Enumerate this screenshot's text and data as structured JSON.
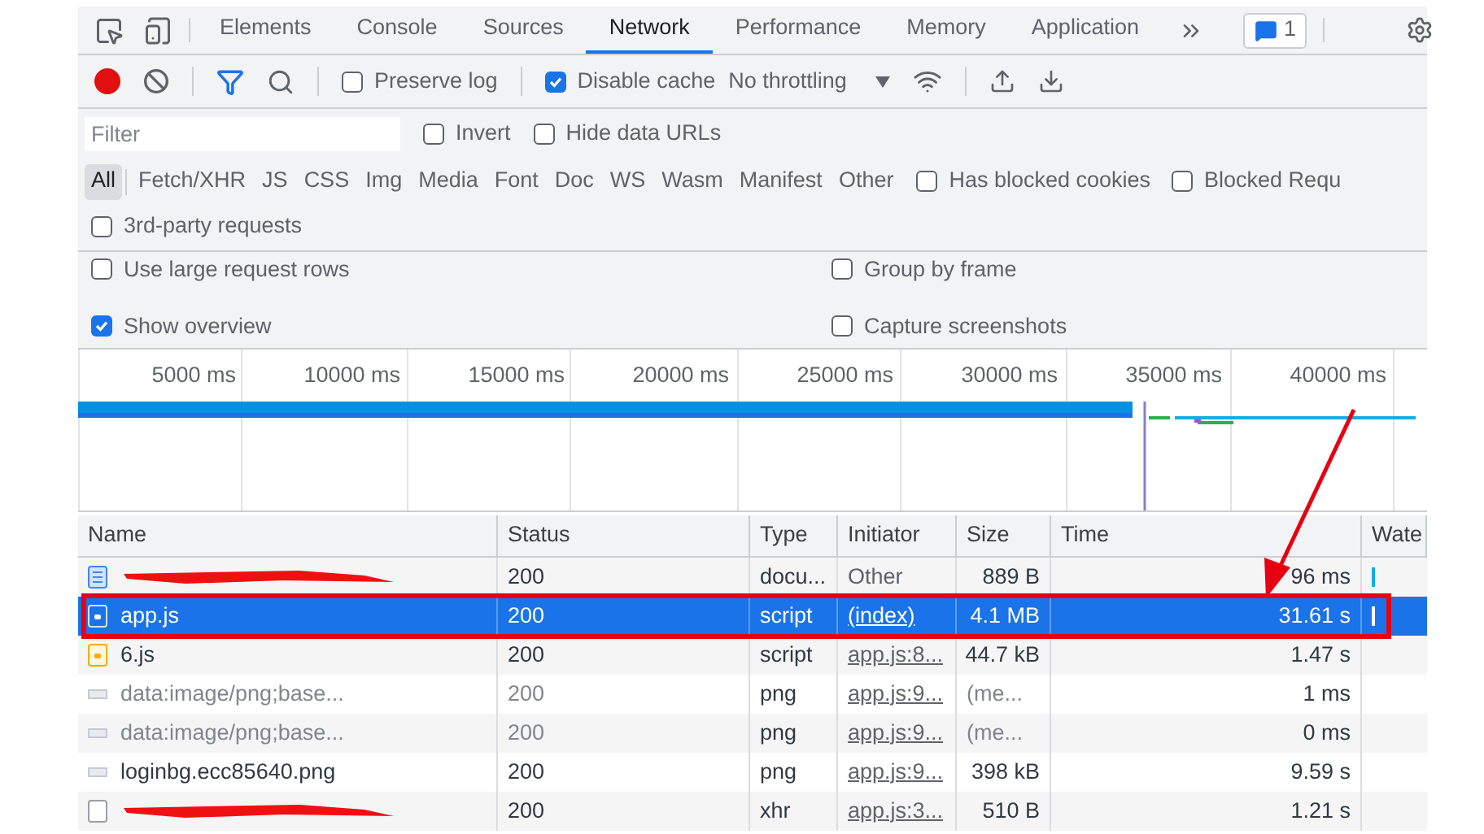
{
  "tabs": [
    {
      "label": "Elements",
      "selected": false
    },
    {
      "label": "Console",
      "selected": false
    },
    {
      "label": "Sources",
      "selected": false
    },
    {
      "label": "Network",
      "selected": true
    },
    {
      "label": "Performance",
      "selected": false
    },
    {
      "label": "Memory",
      "selected": false
    },
    {
      "label": "Application",
      "selected": false
    }
  ],
  "issues_badge": "1",
  "toolbar": {
    "recording": true,
    "filter_on": true,
    "preserve_log": {
      "label": "Preserve log",
      "checked": false
    },
    "disable_cache": {
      "label": "Disable cache",
      "checked": true
    },
    "throttling": "No throttling"
  },
  "filter": {
    "placeholder": "Filter",
    "options": [
      {
        "label": "Invert",
        "checked": false
      },
      {
        "label": "Hide data URLs",
        "checked": false
      }
    ]
  },
  "types": [
    {
      "label": "All",
      "selected": true
    },
    {
      "label": "Fetch/XHR",
      "selected": false
    },
    {
      "label": "JS",
      "selected": false
    },
    {
      "label": "CSS",
      "selected": false
    },
    {
      "label": "Img",
      "selected": false
    },
    {
      "label": "Media",
      "selected": false
    },
    {
      "label": "Font",
      "selected": false
    },
    {
      "label": "Doc",
      "selected": false
    },
    {
      "label": "WS",
      "selected": false
    },
    {
      "label": "Wasm",
      "selected": false
    },
    {
      "label": "Manifest",
      "selected": false
    },
    {
      "label": "Other",
      "selected": false
    }
  ],
  "type_options": [
    {
      "label": "Has blocked cookies",
      "checked": false
    },
    {
      "label": "Blocked Requ",
      "checked": false
    }
  ],
  "third_party": {
    "label": "3rd-party requests",
    "checked": false
  },
  "settings": [
    {
      "label": "Use large request rows",
      "checked": false
    },
    {
      "label": "Group by frame",
      "checked": false
    },
    {
      "label": "Show overview",
      "checked": true
    },
    {
      "label": "Capture screenshots",
      "checked": false
    }
  ],
  "overview": {
    "ticks": [
      "5000 ms",
      "10000 ms",
      "15000 ms",
      "20000 ms",
      "25000 ms",
      "30000 ms",
      "35000 ms",
      "40000 ms"
    ]
  },
  "table": {
    "columns": [
      "Name",
      "Status",
      "Type",
      "Initiator",
      "Size",
      "Time",
      "Wate"
    ],
    "rows": [
      {
        "kind": "doc",
        "redacted": true,
        "status": "200",
        "type": "docu...",
        "initiator": "Other",
        "initiator_link": false,
        "size": "889 B",
        "time": "96 ms",
        "selected": false,
        "dimmed": false
      },
      {
        "kind": "script",
        "redacted": false,
        "name": "app.js",
        "status": "200",
        "type": "script",
        "initiator": "(index)",
        "initiator_link": true,
        "size": "4.1 MB",
        "time": "31.61 s",
        "selected": true,
        "dimmed": false
      },
      {
        "kind": "script",
        "redacted": false,
        "name": "6.js",
        "status": "200",
        "type": "script",
        "initiator": "app.js:8...",
        "initiator_link": true,
        "size": "44.7 kB",
        "time": "1.47 s",
        "selected": false,
        "dimmed": false
      },
      {
        "kind": "image",
        "redacted": false,
        "name": "data:image/png;base...",
        "status": "200",
        "type": "png",
        "initiator": "app.js:9...",
        "initiator_link": true,
        "size": "(me...",
        "time": "1 ms",
        "selected": false,
        "dimmed": true
      },
      {
        "kind": "image",
        "redacted": false,
        "name": "data:image/png;base...",
        "status": "200",
        "type": "png",
        "initiator": "app.js:9...",
        "initiator_link": true,
        "size": "(me...",
        "time": "0 ms",
        "selected": false,
        "dimmed": true
      },
      {
        "kind": "image",
        "redacted": false,
        "name": "loginbg.ecc85640.png",
        "status": "200",
        "type": "png",
        "initiator": "app.js:9...",
        "initiator_link": true,
        "size": "398 kB",
        "time": "9.59 s",
        "selected": false,
        "dimmed": false
      },
      {
        "kind": "file",
        "redacted": true,
        "status": "200",
        "type": "xhr",
        "initiator": "app.js:3...",
        "initiator_link": true,
        "size": "510 B",
        "time": "1.21 s",
        "selected": false,
        "dimmed": false
      }
    ]
  }
}
